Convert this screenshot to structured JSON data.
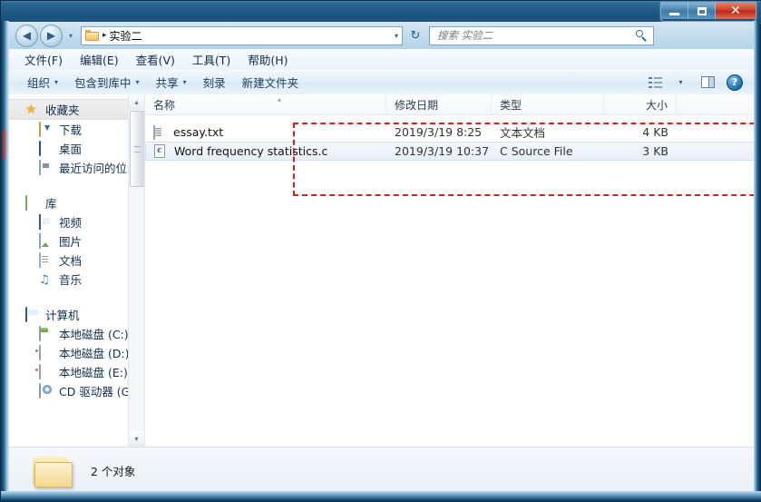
{
  "window": {
    "title": "",
    "controls": {
      "minimize": "–",
      "maximize": "□",
      "close": "✕"
    }
  },
  "nav": {
    "back_icon": "◀",
    "forward_icon": "▶",
    "history_caret": "▾",
    "breadcrumb_separator": "▸",
    "breadcrumb": "实验二",
    "address_caret": "▾",
    "refresh_icon": "↻"
  },
  "search": {
    "placeholder": "搜索 实验二",
    "value": ""
  },
  "menubar": {
    "items": [
      {
        "label": "文件(F)"
      },
      {
        "label": "编辑(E)"
      },
      {
        "label": "查看(V)"
      },
      {
        "label": "工具(T)"
      },
      {
        "label": "帮助(H)"
      }
    ]
  },
  "commandbar": {
    "items": [
      {
        "label": "组织",
        "caret": "▾"
      },
      {
        "label": "包含到库中",
        "caret": "▾"
      },
      {
        "label": "共享",
        "caret": "▾"
      },
      {
        "label": "刻录",
        "caret": ""
      },
      {
        "label": "新建文件夹",
        "caret": ""
      }
    ],
    "view_caret": "▾",
    "help_label": "?"
  },
  "sidebar": {
    "groups": [
      {
        "header": {
          "label": "收藏夹",
          "icon": "star-icon",
          "selected": true
        },
        "items": [
          {
            "label": "下载",
            "icon": "downloads-icon"
          },
          {
            "label": "桌面",
            "icon": "desktop-icon"
          },
          {
            "label": "最近访问的位置",
            "icon": "recent-places-icon"
          }
        ]
      },
      {
        "header": {
          "label": "库",
          "icon": "library-icon",
          "selected": false
        },
        "items": [
          {
            "label": "视频",
            "icon": "video-icon"
          },
          {
            "label": "图片",
            "icon": "pictures-icon"
          },
          {
            "label": "文档",
            "icon": "documents-icon"
          },
          {
            "label": "音乐",
            "icon": "music-icon"
          }
        ]
      },
      {
        "header": {
          "label": "计算机",
          "icon": "computer-icon",
          "selected": false
        },
        "items": [
          {
            "label": "本地磁盘 (C:)",
            "icon": "system-drive-icon"
          },
          {
            "label": "本地磁盘 (D:)",
            "icon": "hard-drive-icon"
          },
          {
            "label": "本地磁盘 (E:)",
            "icon": "hard-drive-icon"
          },
          {
            "label": "CD 驱动器 (G:)",
            "icon": "cd-drive-icon"
          }
        ]
      }
    ],
    "scroll_up": "▴",
    "scroll_down": "▾"
  },
  "filelist": {
    "columns": [
      {
        "key": "name",
        "label": "名称"
      },
      {
        "key": "date",
        "label": "修改日期"
      },
      {
        "key": "type",
        "label": "类型"
      },
      {
        "key": "size",
        "label": "大小"
      }
    ],
    "sort_indicator": "▴",
    "rows": [
      {
        "name": "essay.txt",
        "date": "2019/3/19 8:25",
        "type": "文本文档",
        "size": "4 KB",
        "icon": "text-file-icon",
        "selected": false
      },
      {
        "name": "Word frequency statistics.c",
        "date": "2019/3/19 10:37",
        "type": "C Source File",
        "size": "3 KB",
        "icon": "c-source-file-icon",
        "selected": true
      }
    ]
  },
  "annotation": {
    "color": "#e01b1b",
    "style": "dashed-rectangle"
  },
  "statusbar": {
    "text": "2 个对象",
    "icon": "folder-icon"
  },
  "colors": {
    "titlebar": "#1d5581",
    "close_button": "#c0392b",
    "selection": "#eef4fb",
    "annotation_red": "#e01b1b"
  }
}
